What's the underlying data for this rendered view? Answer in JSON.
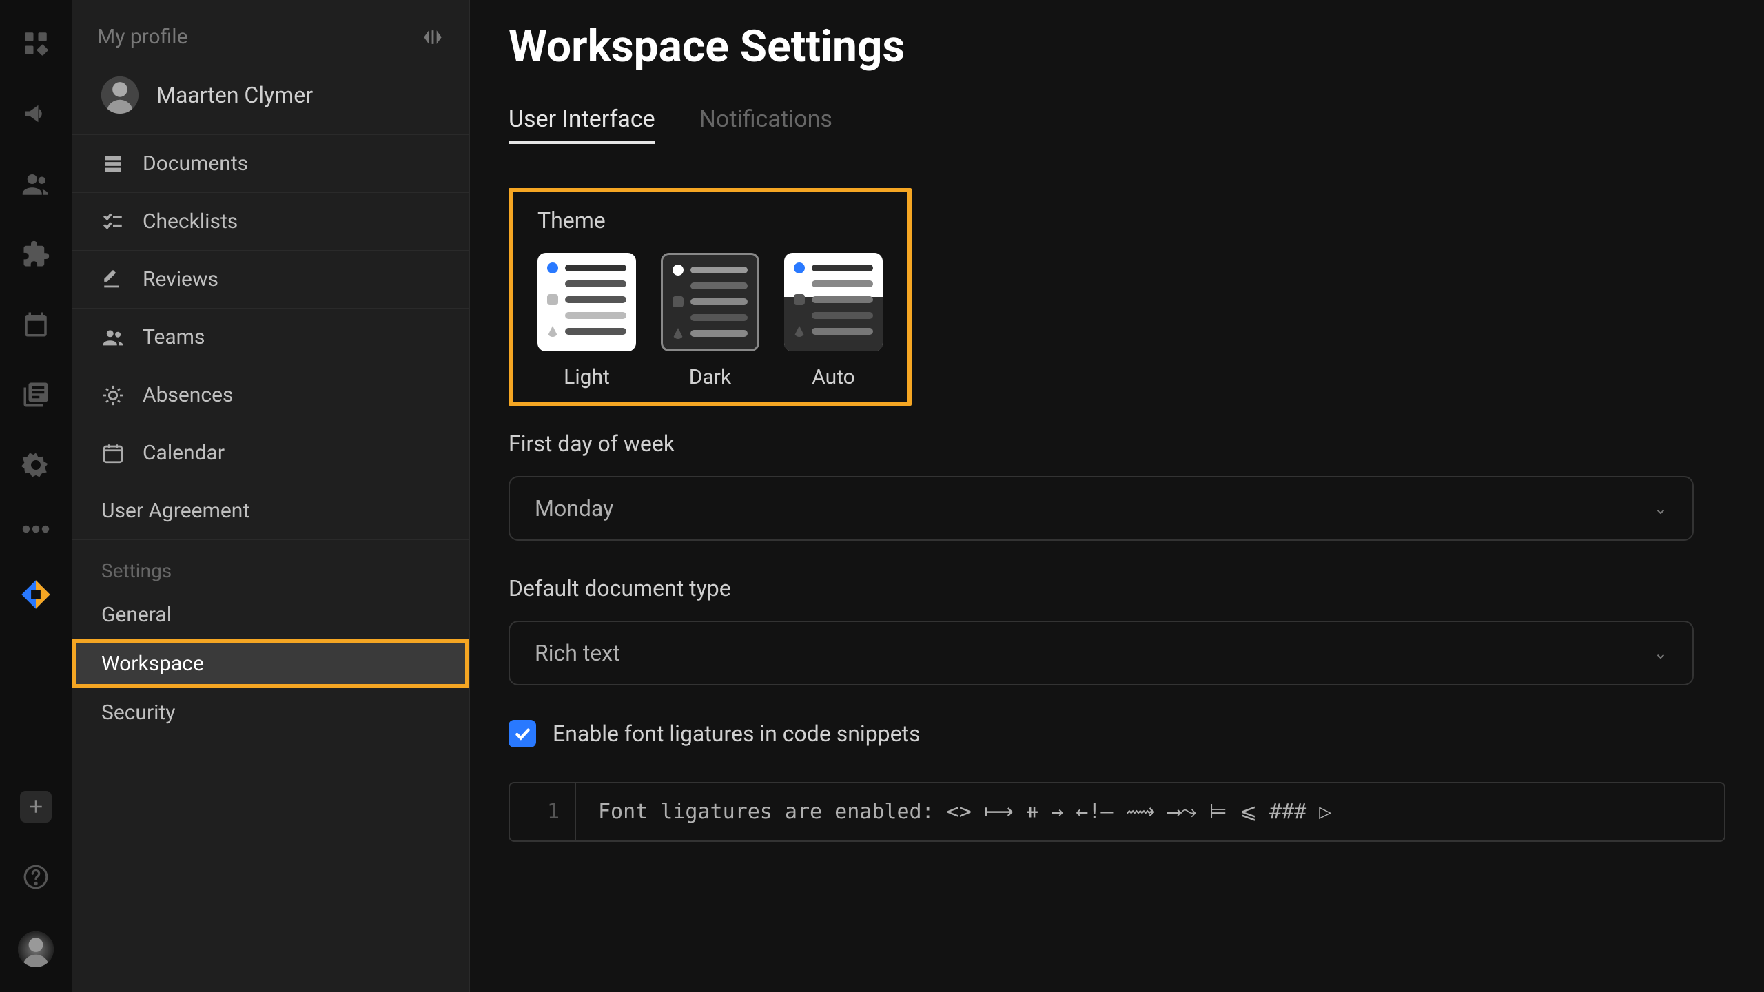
{
  "rail": {},
  "sidebar": {
    "title": "My profile",
    "profile_name": "Maarten Clymer",
    "nav": [
      {
        "label": "Documents"
      },
      {
        "label": "Checklists"
      },
      {
        "label": "Reviews"
      },
      {
        "label": "Teams"
      },
      {
        "label": "Absences"
      },
      {
        "label": "Calendar"
      }
    ],
    "user_agreement": "User Agreement",
    "settings_label": "Settings",
    "settings_items": [
      {
        "label": "General"
      },
      {
        "label": "Workspace"
      },
      {
        "label": "Security"
      }
    ]
  },
  "main": {
    "page_title": "Workspace Settings",
    "tabs": [
      {
        "label": "User Interface"
      },
      {
        "label": "Notifications"
      }
    ],
    "theme_label": "Theme",
    "theme_options": [
      "Light",
      "Dark",
      "Auto"
    ],
    "first_day_label": "First day of week",
    "first_day_value": "Monday",
    "doc_type_label": "Default document type",
    "doc_type_value": "Rich text",
    "ligatures_label": "Enable font ligatures in code snippets",
    "code_line_no": "1",
    "code_content": "Font ligatures are enabled: <> ⟼ ⧺ → ←!— ⟿ ⟶⤳ ⊨ ⩽ ### ▷"
  }
}
